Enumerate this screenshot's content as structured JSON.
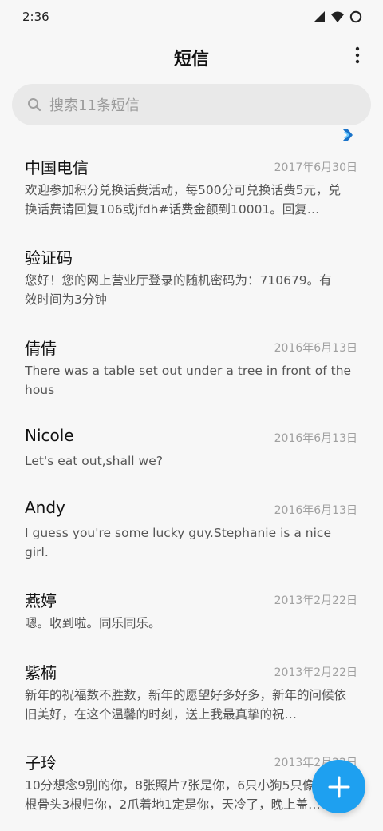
{
  "status_bar": {
    "time": "2:36",
    "icons": [
      "signal-icon",
      "wifi-icon",
      "battery-icon"
    ]
  },
  "header": {
    "title": "短信",
    "more_icon": "more-vertical-icon"
  },
  "search": {
    "placeholder": "搜索11条短信",
    "icon": "search-icon"
  },
  "messages": [
    {
      "name": "中国电信",
      "date": "2017年6月30日",
      "preview": "欢迎参加积分兑换话费活动，每500分可兑换话费5元，兑换话费请回复106或jfdh#话费金额到10001。回复…"
    },
    {
      "name": "验证码",
      "date": "",
      "preview": "您好！您的网上营业厅登录的随机密码为：710679。有效时间为3分钟",
      "icon": "verification-code-icon"
    },
    {
      "name": "倩倩",
      "date": "2016年6月13日",
      "preview": "There was a table set out under a tree in front of the hous"
    },
    {
      "name": "Nicole",
      "date": "2016年6月13日",
      "preview": "Let's eat out,shall we?"
    },
    {
      "name": "Andy",
      "date": "2016年6月13日",
      "preview": "I guess you're some lucky guy.Stephanie is a nice girl."
    },
    {
      "name": "燕婷",
      "date": "2013年2月22日",
      "preview": "嗯。收到啦。同乐同乐。"
    },
    {
      "name": "紫楠",
      "date": "2013年2月22日",
      "preview": "新年的祝福数不胜数，新年的愿望好多好多，新年的问候依旧美好，在这个温馨的时刻，送上我最真挚的祝…"
    },
    {
      "name": "子玲",
      "date": "2013年2月22日",
      "preview": "10分想念9别的你，8张照片7张是你，6只小狗5只像你，4根骨头3根归你，2爪着地1定是你，天冷了，晚上盖…"
    }
  ],
  "fab": {
    "icon": "plus-icon",
    "color": "#1ea0f0"
  }
}
